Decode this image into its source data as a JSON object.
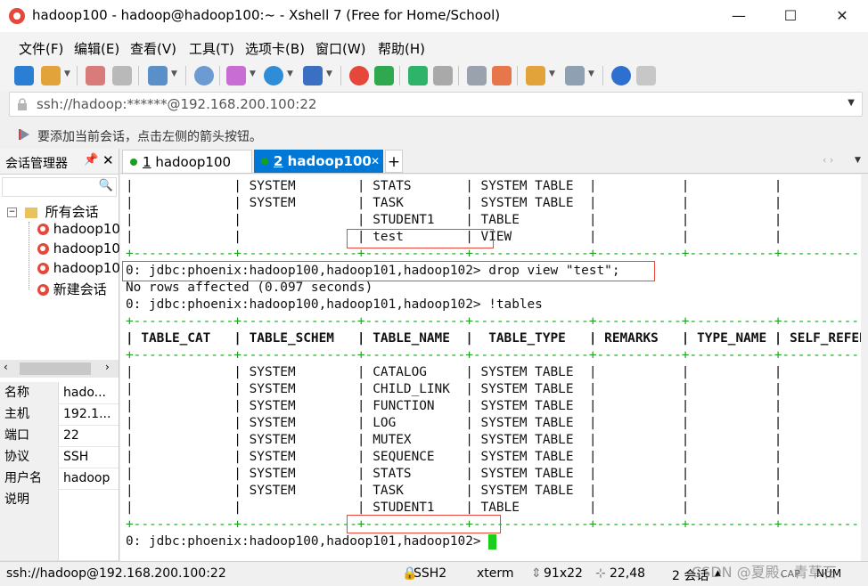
{
  "window": {
    "title": "hadoop100 - hadoop@hadoop100:~ - Xshell 7 (Free for Home/School)",
    "controls": {
      "minimize": "—",
      "maximize": "☐",
      "close": "✕"
    }
  },
  "menu": [
    "文件(F)",
    "编辑(E)",
    "查看(V)",
    "工具(T)",
    "选项卡(B)",
    "窗口(W)",
    "帮助(H)"
  ],
  "address": {
    "value": "ssh://hadoop:******@192.168.200.100:22"
  },
  "hint": "要添加当前会话，点击左侧的箭头按钮。",
  "session_panel": {
    "title": "会话管理器",
    "pin": "ᵖ",
    "close": "✕",
    "root": "所有会话",
    "sessions": [
      "hadoop10",
      "hadoop10",
      "hadoop10",
      "新建会话"
    ],
    "props": [
      {
        "k": "名称",
        "v": "hado..."
      },
      {
        "k": "主机",
        "v": "192.1..."
      },
      {
        "k": "端口",
        "v": "22"
      },
      {
        "k": "协议",
        "v": "SSH"
      },
      {
        "k": "用户名",
        "v": "hadoop"
      },
      {
        "k": "说明",
        "v": ""
      }
    ]
  },
  "tabs": [
    {
      "num": "1",
      "label": "hadoop100",
      "active": false
    },
    {
      "num": "2",
      "label": "hadoop100",
      "active": true
    }
  ],
  "terminal": {
    "lines": [
      {
        "text": "|             | SYSTEM        | STATS       | SYSTEM TABLE  |           |           |            |",
        "kind": "row"
      },
      {
        "text": "|             | SYSTEM        | TASK        | SYSTEM TABLE  |           |           |            |",
        "kind": "row"
      },
      {
        "text": "|             |               | STUDENT1    | TABLE         |           |           |            |",
        "kind": "row"
      },
      {
        "text": "|             |               | test        | VIEW          |           |           |            |",
        "kind": "row"
      },
      {
        "text": "+-------------+---------------+-------------+---------------+-----------+-----------+------------+",
        "kind": "border"
      },
      {
        "text": "0: jdbc:phoenix:hadoop100,hadoop101,hadoop102> drop view \"test\";",
        "kind": "cmd"
      },
      {
        "text": "No rows affected (0.097 seconds)",
        "kind": "out"
      },
      {
        "text": "0: jdbc:phoenix:hadoop100,hadoop101,hadoop102> !tables",
        "kind": "cmd"
      },
      {
        "text": "+-------------+---------------+-------------+---------------+-----------+-----------+------------+",
        "kind": "border"
      },
      {
        "text": "| TABLE_CAT   | TABLE_SCHEM   | TABLE_NAME  |  TABLE_TYPE   | REMARKS   | TYPE_NAME | SELF_REFERE|",
        "kind": "header"
      },
      {
        "text": "+-------------+---------------+-------------+---------------+-----------+-----------+------------+",
        "kind": "border"
      },
      {
        "text": "|             | SYSTEM        | CATALOG     | SYSTEM TABLE  |           |           |            |",
        "kind": "row"
      },
      {
        "text": "|             | SYSTEM        | CHILD_LINK  | SYSTEM TABLE  |           |           |            |",
        "kind": "row"
      },
      {
        "text": "|             | SYSTEM        | FUNCTION    | SYSTEM TABLE  |           |           |            |",
        "kind": "row"
      },
      {
        "text": "|             | SYSTEM        | LOG         | SYSTEM TABLE  |           |           |            |",
        "kind": "row"
      },
      {
        "text": "|             | SYSTEM        | MUTEX       | SYSTEM TABLE  |           |           |            |",
        "kind": "row"
      },
      {
        "text": "|             | SYSTEM        | SEQUENCE    | SYSTEM TABLE  |           |           |            |",
        "kind": "row"
      },
      {
        "text": "|             | SYSTEM        | STATS       | SYSTEM TABLE  |           |           |            |",
        "kind": "row"
      },
      {
        "text": "|             | SYSTEM        | TASK        | SYSTEM TABLE  |           |           |            |",
        "kind": "row"
      },
      {
        "text": "|             |               | STUDENT1    | TABLE         |           |           |            |",
        "kind": "row"
      },
      {
        "text": "+-------------+---------------+-------------+---------------+-----------+-----------+------------+",
        "kind": "border"
      },
      {
        "text": "0: jdbc:phoenix:hadoop100,hadoop101,hadoop102> ",
        "kind": "cmd"
      }
    ]
  },
  "status": {
    "conn": "ssh://hadoop@192.168.200.100:22",
    "proto": "SSH2",
    "term": "xterm",
    "size": "91x22",
    "pos": "22,48",
    "sessions": "2 会话",
    "caps": "CAP",
    "num": "NUM",
    "watermark": "CSDN @夏殿、青草石"
  },
  "colors": {
    "accent": "#0078d7",
    "highlight": "#e8483b",
    "term_green": "#16a51a"
  }
}
